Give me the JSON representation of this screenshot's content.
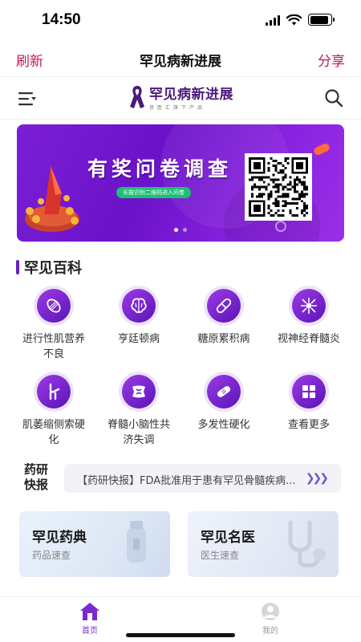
{
  "status_bar": {
    "time": "14:50",
    "battery_level": 0.9,
    "signal_bars": 4
  },
  "nav": {
    "left": "刷新",
    "title": "罕见病新进展",
    "right": "分享"
  },
  "header": {
    "logo_main": "罕见病新进展",
    "logo_sub": "良医汇旗下产品",
    "menu_icon": "menu-list-icon",
    "search_icon": "search-icon"
  },
  "banner": {
    "title": "有奖问卷调查",
    "pill": "长按识别二维码进入问卷",
    "slide_count": 2,
    "active_slide": 1
  },
  "section": {
    "title": "罕见百科"
  },
  "grid": [
    {
      "label": "进行性肌营养不良",
      "icon": "muscle-icon"
    },
    {
      "label": "亨廷顿病",
      "icon": "brain-icon"
    },
    {
      "label": "糖原累积病",
      "icon": "capsule-icon"
    },
    {
      "label": "视神经脊髓炎",
      "icon": "neuron-icon"
    },
    {
      "label": "肌萎缩侧索硬化",
      "icon": "joint-icon"
    },
    {
      "label": "脊髓小脑性共济失调",
      "icon": "vertebra-icon"
    },
    {
      "label": "多发性硬化",
      "icon": "bandage-icon"
    },
    {
      "label": "查看更多",
      "icon": "grid-more-icon"
    }
  ],
  "news": {
    "badge": "药研快报",
    "text": "【药研快报】FDA批准用于患有罕见骨髓疾病...",
    "arrow_icon": "triple-chevron-right-icon"
  },
  "cards": [
    {
      "title": "罕见药典",
      "subtitle": "药品速查"
    },
    {
      "title": "罕见名医",
      "subtitle": "医生速查"
    }
  ],
  "tabs": [
    {
      "label": "首页",
      "icon": "home-icon",
      "active": true
    },
    {
      "label": "我的",
      "icon": "profile-icon",
      "active": false
    }
  ],
  "colors": {
    "accent": "#7b2ad1",
    "nav_action": "#c2185b",
    "banner": "#7b1fd6"
  }
}
